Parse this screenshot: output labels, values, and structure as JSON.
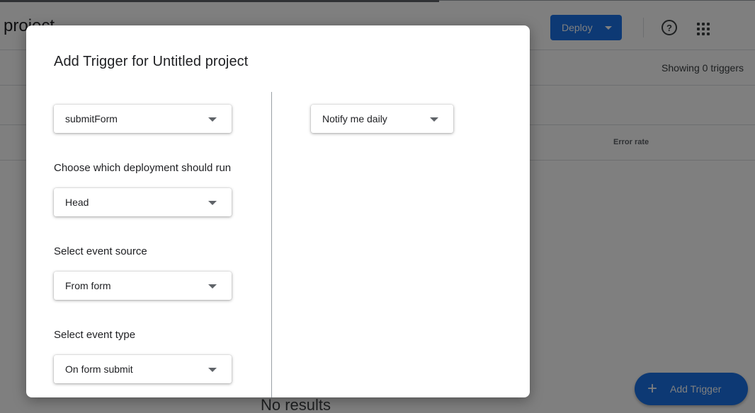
{
  "app": {
    "title": "project",
    "deploy_label": "Deploy",
    "showing_label": "Showing 0 triggers",
    "error_rate_header": "Error rate",
    "no_results": "No results",
    "add_trigger_label": "Add Trigger",
    "icons": {
      "deploy_caret": "caret-down-icon",
      "help": "help-circle-icon",
      "apps": "apps-grid-icon",
      "add": "plus-icon"
    }
  },
  "dialog": {
    "title": "Add Trigger for Untitled project",
    "function_select": {
      "value": "submitForm"
    },
    "deployment": {
      "label": "Choose which deployment should run",
      "value": "Head"
    },
    "event_source": {
      "label": "Select event source",
      "value": "From form"
    },
    "event_type": {
      "label": "Select event type",
      "value": "On form submit"
    },
    "notification": {
      "value": "Notify me daily"
    }
  },
  "colors": {
    "accent": "#1a73e8",
    "scrim": "rgba(0,0,0,0.5)"
  }
}
